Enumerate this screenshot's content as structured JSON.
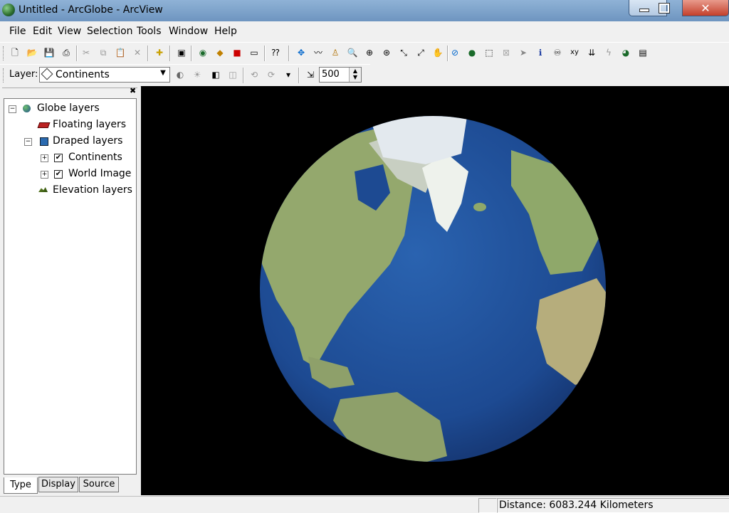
{
  "window": {
    "title": "Untitled - ArcGlobe - ArcView"
  },
  "menu": [
    "File",
    "Edit",
    "View",
    "Selection",
    "Tools",
    "Window",
    "Help"
  ],
  "toolbar1_icons": [
    "new-icon",
    "open-icon",
    "save-icon",
    "print-icon",
    "cut-icon",
    "copy-icon",
    "paste-icon",
    "delete-icon",
    "add-data-icon",
    "full-screen-icon",
    "globe-properties-icon",
    "layer-icon",
    "arctoolbox-icon",
    "window-icon",
    "whats-this-icon",
    "navigate-icon",
    "fly-icon",
    "observer-icon",
    "zoom-in-out-icon",
    "target-icon",
    "zoom-target-icon",
    "zoom-in-icon",
    "zoom-out-icon",
    "pan-icon",
    "full-extent-icon",
    "globe-icon",
    "select-icon",
    "clear-select-icon",
    "pointer-icon",
    "identify-icon",
    "find-icon",
    "xy-icon",
    "measure-icon",
    "hyperlink-icon",
    "animation-icon",
    "notes-icon"
  ],
  "toolbar2": {
    "layer_label": "Layer:",
    "layer_value": "Continents",
    "scale_value": "500"
  },
  "toc": {
    "root": "Globe layers",
    "floating": "Floating layers",
    "draped": "Draped layers",
    "continents": "Continents",
    "world_image": "World Image",
    "elevation": "Elevation layers",
    "expand_sign": "⊟",
    "collapse_sign": "⊞",
    "check_mark": "✔"
  },
  "tabs": {
    "type": "Type",
    "display": "Display",
    "source": "Source"
  },
  "status": {
    "distance": "Distance:  6083.244 Kilometers"
  },
  "colors": {
    "ocean": "#1e4d96",
    "land": "#8fa86a",
    "ice": "#e8eef3",
    "background": "#000000"
  }
}
